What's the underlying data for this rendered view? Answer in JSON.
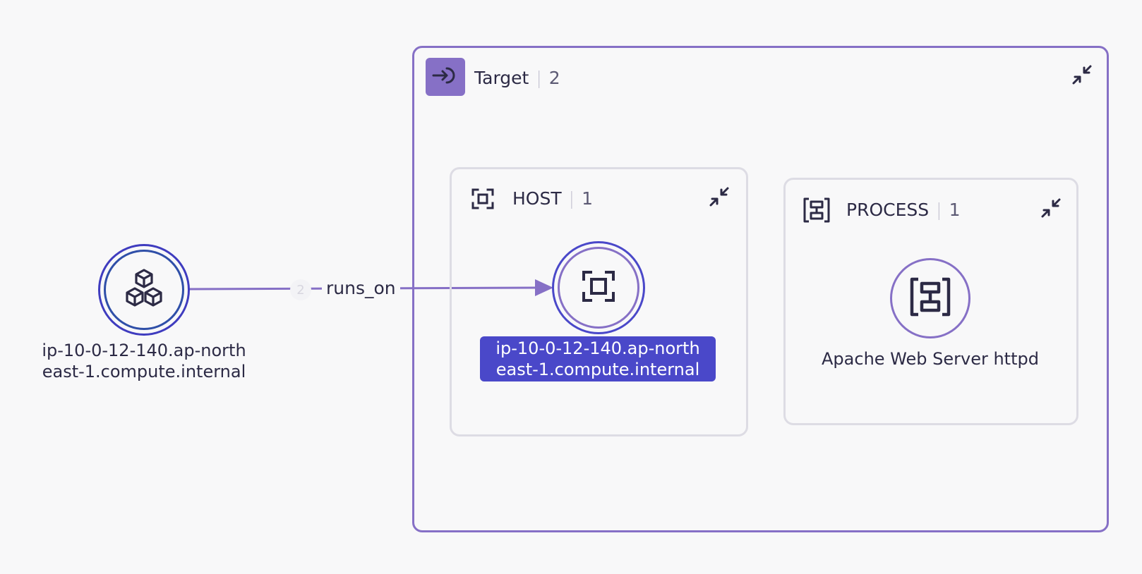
{
  "source_node": {
    "label_line1": "ip-10-0-12-140.ap-north",
    "label_line2": "east-1.compute.internal",
    "icon": "cubes-icon"
  },
  "edge": {
    "label": "runs_on",
    "count": "2"
  },
  "target_group": {
    "title": "Target",
    "count": "2",
    "icon": "target-enter-icon",
    "accent": "#8670c6"
  },
  "host_group": {
    "title": "HOST",
    "count": "1",
    "icon": "host-frame-icon",
    "node": {
      "label_line1": "ip-10-0-12-140.ap-north",
      "label_line2": "east-1.compute.internal",
      "selected_color": "#4a48c9"
    }
  },
  "process_group": {
    "title": "PROCESS",
    "count": "1",
    "icon": "process-icon",
    "node": {
      "label": "Apache Web Server httpd"
    }
  }
}
